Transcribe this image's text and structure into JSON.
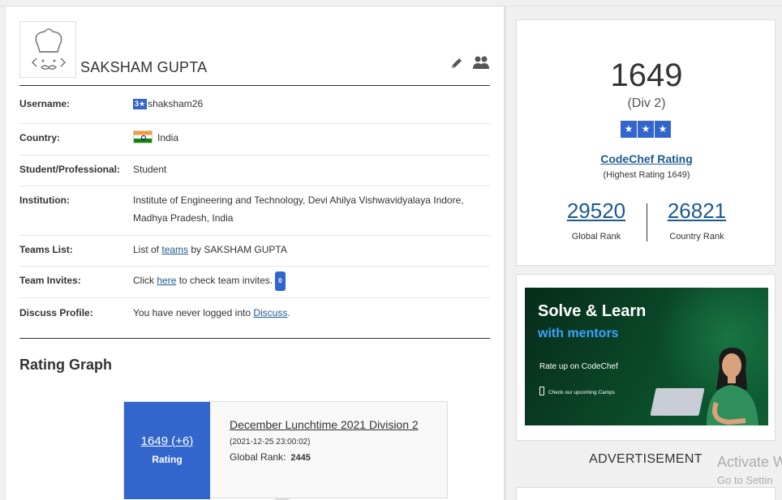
{
  "profile": {
    "name": "SAKSHAM GUPTA",
    "rows": {
      "username_label": "Username:",
      "username_stars": "3★",
      "username": "shaksham26",
      "country_label": "Country:",
      "country": "India",
      "student_label": "Student/Professional:",
      "student": "Student",
      "institution_label": "Institution:",
      "institution": "Institute of Engineering and Technology, Devi Ahilya Vishwavidyalaya Indore, Madhya Pradesh, India",
      "teams_label": "Teams List:",
      "teams_prefix": "List of ",
      "teams_link": "teams",
      "teams_suffix": " by SAKSHAM GUPTA",
      "invites_label": "Team Invites:",
      "invites_prefix": "Click ",
      "invites_link": "here",
      "invites_suffix": " to check team invites.",
      "invites_count": "0",
      "discuss_label": "Discuss Profile:",
      "discuss_prefix": "You have never logged into ",
      "discuss_link": "Discuss",
      "discuss_suffix": "."
    }
  },
  "rating_graph": {
    "title": "Rating Graph",
    "tooltip": {
      "rating": "1649 (+6)",
      "rating_label": "Rating",
      "contest": "December Lunchtime 2021 Division 2",
      "date": "(2021-12-25 23:00:02)",
      "global_rank_label": "Global Rank:",
      "global_rank": "2445"
    }
  },
  "rating_card": {
    "rating": "1649",
    "division": "(Div 2)",
    "stars": [
      "★",
      "★",
      "★"
    ],
    "link": "CodeChef Rating",
    "highest": "(Highest Rating 1649)",
    "global_rank": "29520",
    "global_rank_label": "Global Rank",
    "country_rank": "26821",
    "country_rank_label": "Country Rank"
  },
  "ad": {
    "title1": "Solve & Learn",
    "title2": "with mentors",
    "subtitle": "Rate up on CodeChef",
    "small": "Check our upcoming Camps",
    "label": "ADVERTISEMENT"
  },
  "watermark": {
    "line1": "Activate W",
    "line2": "Go to Settin"
  },
  "colors": {
    "accent": "#3366cc",
    "link": "#1c5a8f"
  }
}
